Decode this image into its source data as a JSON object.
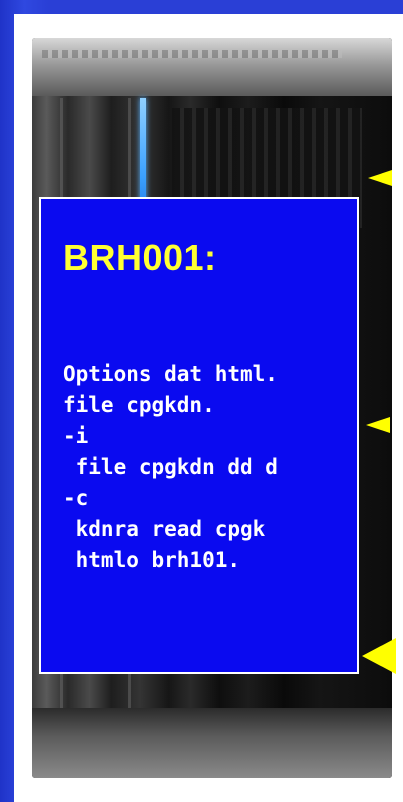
{
  "panel": {
    "title": "BRH001:",
    "code_lines": [
      "Options dat html.",
      "file cpgkdn.",
      "-i",
      " file cpgkdn dd d",
      "-c",
      " kdnra read cpgk",
      " htmlo brh101."
    ]
  },
  "colors": {
    "background_blue": "#2a3fd6",
    "panel_blue": "#0a0af0",
    "title_yellow": "#ffff33",
    "arrow_yellow": "#ffff00"
  },
  "decorations": {
    "background_image": "server-rack-photo",
    "arrows": [
      "arrow-left-icon",
      "arrow-left-icon",
      "arrow-left-icon"
    ]
  }
}
